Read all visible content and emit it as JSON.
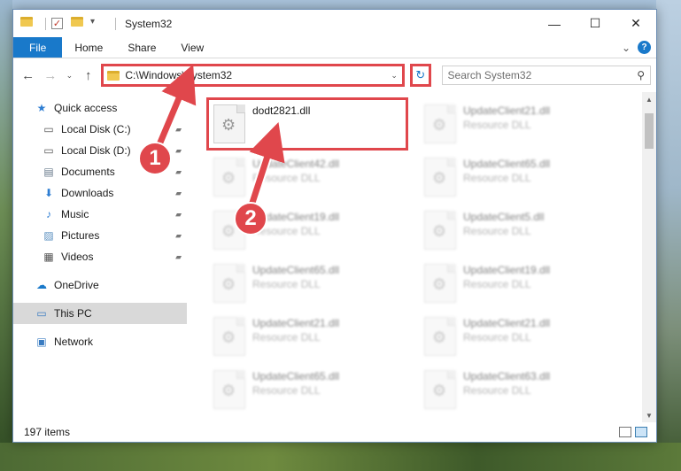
{
  "window": {
    "title": "System32",
    "controls": {
      "minimize": "—",
      "maximize": "☐",
      "close": "✕"
    }
  },
  "ribbon": {
    "tabs": [
      "File",
      "Home",
      "Share",
      "View"
    ],
    "expand": "⌄",
    "help": "?"
  },
  "address": {
    "path": "C:\\Windows\\System32",
    "dropdown": "⌄",
    "refresh": "↻"
  },
  "nav_buttons": {
    "back": "←",
    "forward": "→",
    "recent": "⌄",
    "up": "↑"
  },
  "search": {
    "placeholder": "Search System32",
    "icon": "⚲"
  },
  "nav_pane": {
    "items": [
      {
        "label": "Quick access",
        "icon": "★",
        "pinned": false,
        "indent": false
      },
      {
        "label": "Local Disk (C:)",
        "icon": "▭",
        "pinned": true,
        "indent": true
      },
      {
        "label": "Local Disk (D:)",
        "icon": "▭",
        "pinned": true,
        "indent": true
      },
      {
        "label": "Documents",
        "icon": "▤",
        "pinned": true,
        "indent": true
      },
      {
        "label": "Downloads",
        "icon": "⬇",
        "pinned": true,
        "indent": true
      },
      {
        "label": "Music",
        "icon": "♪",
        "pinned": true,
        "indent": true
      },
      {
        "label": "Pictures",
        "icon": "▨",
        "pinned": true,
        "indent": true
      },
      {
        "label": "Videos",
        "icon": "▦",
        "pinned": true,
        "indent": true
      }
    ],
    "onedrive": "OneDrive",
    "this_pc": "This PC",
    "network": "Network",
    "pin_glyph": "📌"
  },
  "files": {
    "highlighted": {
      "name": "dodt2821.dll"
    },
    "others": [
      {
        "name": "UpdateClient21.dll",
        "type": "Resource DLL"
      },
      {
        "name": "UpdateClient42.dll",
        "type": "Resource DLL"
      },
      {
        "name": "UpdateClient65.dll",
        "type": "Resource DLL"
      },
      {
        "name": "UpdateClient19.dll",
        "type": "Resource DLL"
      },
      {
        "name": "UpdateClient5.dll",
        "type": "Resource DLL"
      },
      {
        "name": "UpdateClient65.dll",
        "type": "Resource DLL"
      },
      {
        "name": "UpdateClient19.dll",
        "type": "Resource DLL"
      },
      {
        "name": "UpdateClient21.dll",
        "type": "Resource DLL"
      },
      {
        "name": "UpdateClient21.dll",
        "type": "Resource DLL"
      },
      {
        "name": "UpdateClient65.dll",
        "type": "Resource DLL"
      },
      {
        "name": "UpdateClient63.dll",
        "type": "Resource DLL"
      }
    ]
  },
  "status": {
    "item_count": "197 items"
  },
  "callouts": [
    "1",
    "2"
  ],
  "colors": {
    "accent": "#1979ca",
    "annotation_red": "#e0474c"
  }
}
